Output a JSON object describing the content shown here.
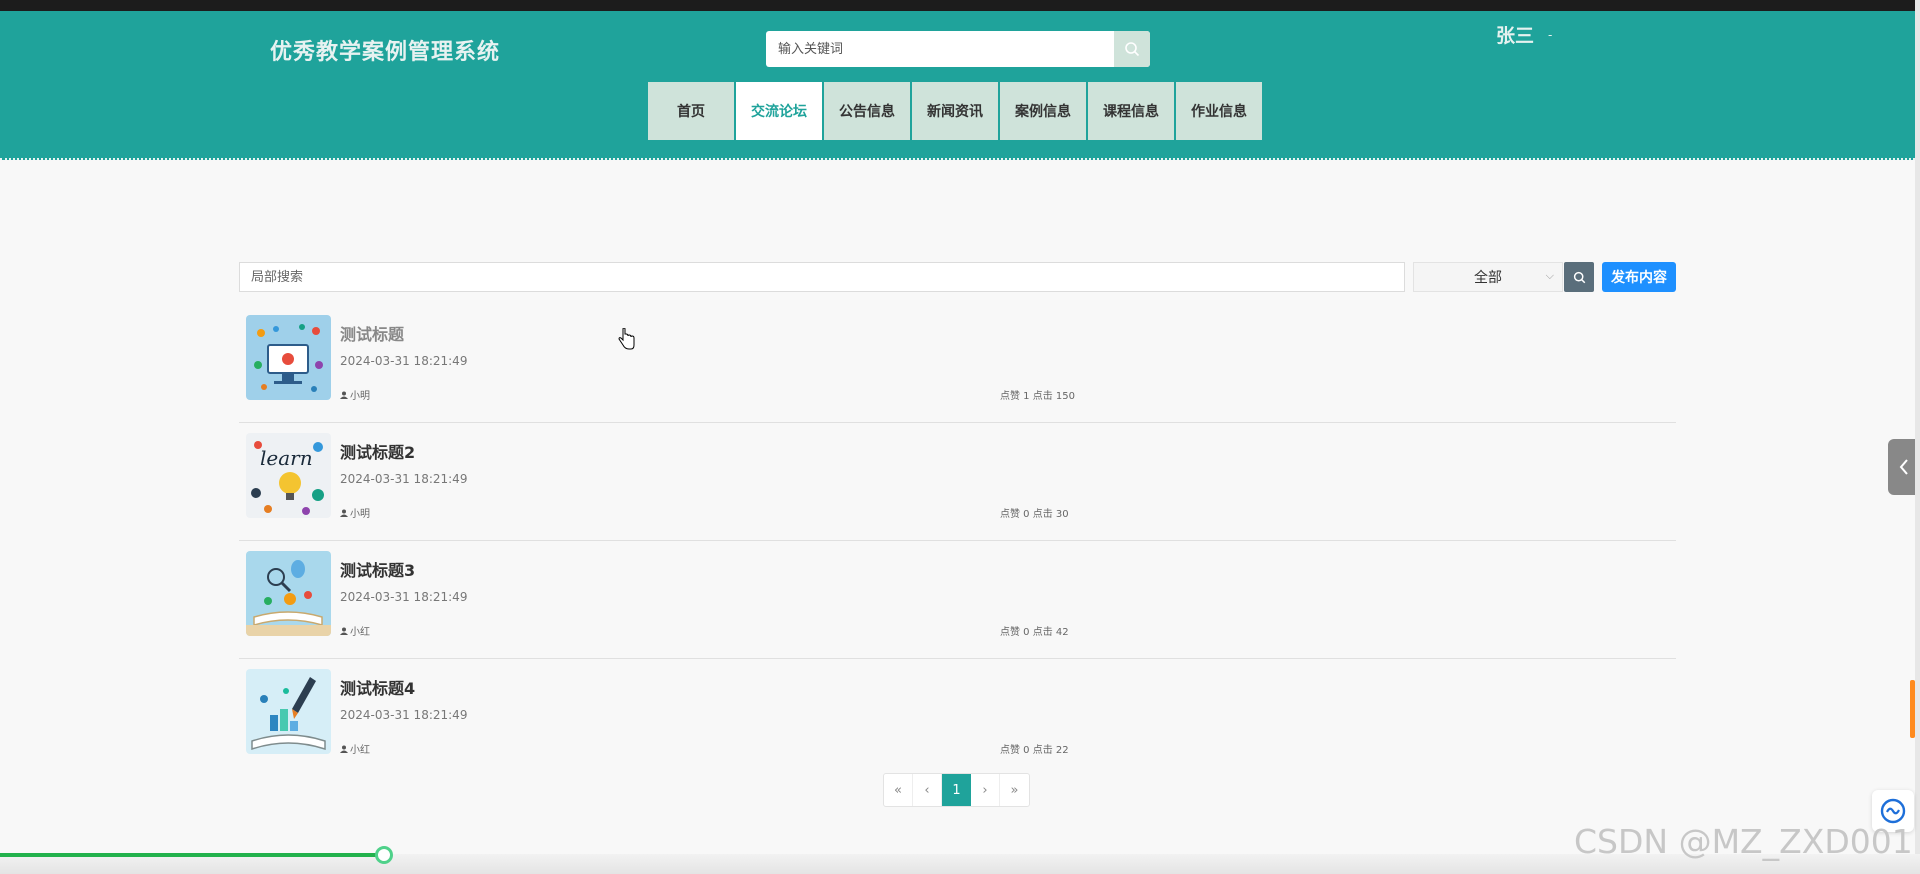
{
  "header": {
    "site_title": "优秀教学案例管理系统",
    "search_placeholder": "输入关键词",
    "user_name": "张三",
    "user_caret": "-"
  },
  "nav": {
    "items": [
      "首页",
      "交流论坛",
      "公告信息",
      "新闻资讯",
      "案例信息",
      "课程信息",
      "作业信息"
    ],
    "active_index": 1
  },
  "filter": {
    "search_placeholder": "局部搜索",
    "select_value": "全部",
    "publish_label": "发布内容"
  },
  "posts": [
    {
      "title": "测试标题",
      "date": "2024-03-31 18:21:49",
      "author": "小明",
      "stats": "点赞 1 点击 150"
    },
    {
      "title": "测试标题2",
      "date": "2024-03-31 18:21:49",
      "author": "小明",
      "stats": "点赞 0 点击 30"
    },
    {
      "title": "测试标题3",
      "date": "2024-03-31 18:21:49",
      "author": "小红",
      "stats": "点赞 0 点击 42"
    },
    {
      "title": "测试标题4",
      "date": "2024-03-31 18:21:49",
      "author": "小红",
      "stats": "点赞 0 点击 22"
    }
  ],
  "pager": {
    "first": "«",
    "prev": "‹",
    "current": "1",
    "next": "›",
    "last": "»"
  },
  "media_progress": 0.2,
  "watermark": "CSDN @MZ_ZXD001",
  "colors": {
    "header_bg": "#1fa39b",
    "nav_bg": "#cfe3da",
    "publish_btn": "#1e90ff",
    "progress": "#22b14c"
  }
}
